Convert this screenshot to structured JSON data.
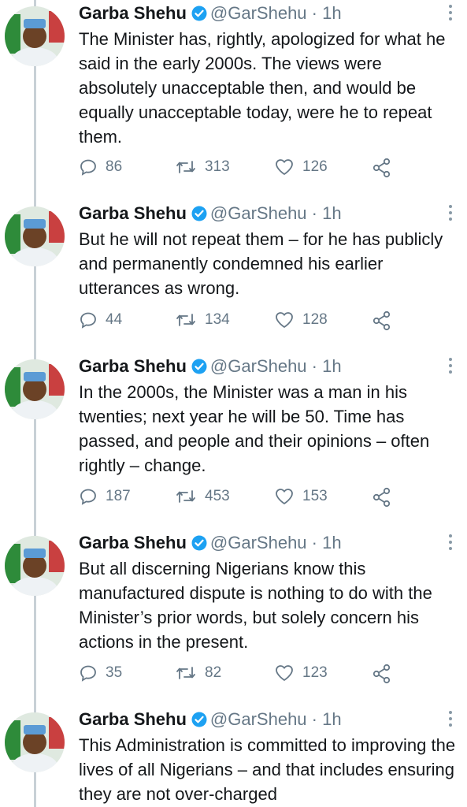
{
  "author": {
    "name": "Garba Shehu",
    "handle": "@GarShehu",
    "dot": "·",
    "time": "1h"
  },
  "colors": {
    "verified": "#1da1f2",
    "text": "#14171a",
    "muted": "#657786",
    "thread_line": "#c8d0d6"
  },
  "icons": [
    "reply-icon",
    "retweet-icon",
    "like-icon",
    "share-icon",
    "verified-badge-icon",
    "more-options-icon"
  ],
  "tweets": [
    {
      "text": "The Minister has, rightly, apologized for what he said in the early 2000s. The views were absolutely unacceptable then, and would be equally unacceptable today, were he to repeat them.",
      "replies": "86",
      "retweets": "313",
      "likes": "126"
    },
    {
      "text": "But he will not repeat them – for he has publicly and permanently condemned his earlier utterances as wrong.",
      "replies": "44",
      "retweets": "134",
      "likes": "128"
    },
    {
      "text": "In the 2000s, the Minister was a man in his twenties; next year he will be 50. Time has passed, and people and their opinions – often rightly – change.",
      "replies": "187",
      "retweets": "453",
      "likes": "153"
    },
    {
      "text": "But all discerning Nigerians know this manufactured dispute is nothing to do with the Minister’s prior words, but solely concern his actions in the present.",
      "replies": "35",
      "retweets": "82",
      "likes": "123"
    },
    {
      "text": "This Administration is committed to improving the lives of all Nigerians – and that includes ensuring they are not over-charged",
      "replies": "",
      "retweets": "",
      "likes": ""
    }
  ]
}
